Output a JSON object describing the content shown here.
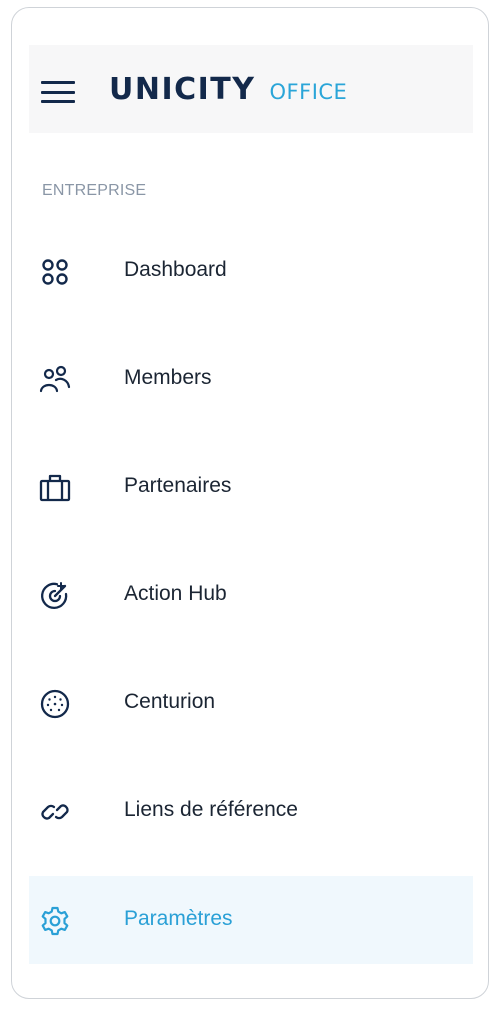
{
  "brand": {
    "name": "UNICITY",
    "product": "OFFICE"
  },
  "sidebar": {
    "section_label": "ENTREPRISE",
    "items": [
      {
        "label": "Dashboard",
        "icon": "dashboard-grid-icon",
        "active": false
      },
      {
        "label": "Members",
        "icon": "members-icon",
        "active": false
      },
      {
        "label": "Partenaires",
        "icon": "briefcase-icon",
        "active": false
      },
      {
        "label": "Action Hub",
        "icon": "target-icon",
        "active": false
      },
      {
        "label": "Centurion",
        "icon": "centurion-icon",
        "active": false
      },
      {
        "label": "Liens de référence",
        "icon": "link-icon",
        "active": false
      },
      {
        "label": "Paramètres",
        "icon": "gear-icon",
        "active": true
      }
    ]
  },
  "colors": {
    "brand_navy": "#13294b",
    "accent_blue": "#2aa5d8",
    "active_bg": "#f0f8fd",
    "section_label": "#8a96a6",
    "text": "#1b2533"
  }
}
